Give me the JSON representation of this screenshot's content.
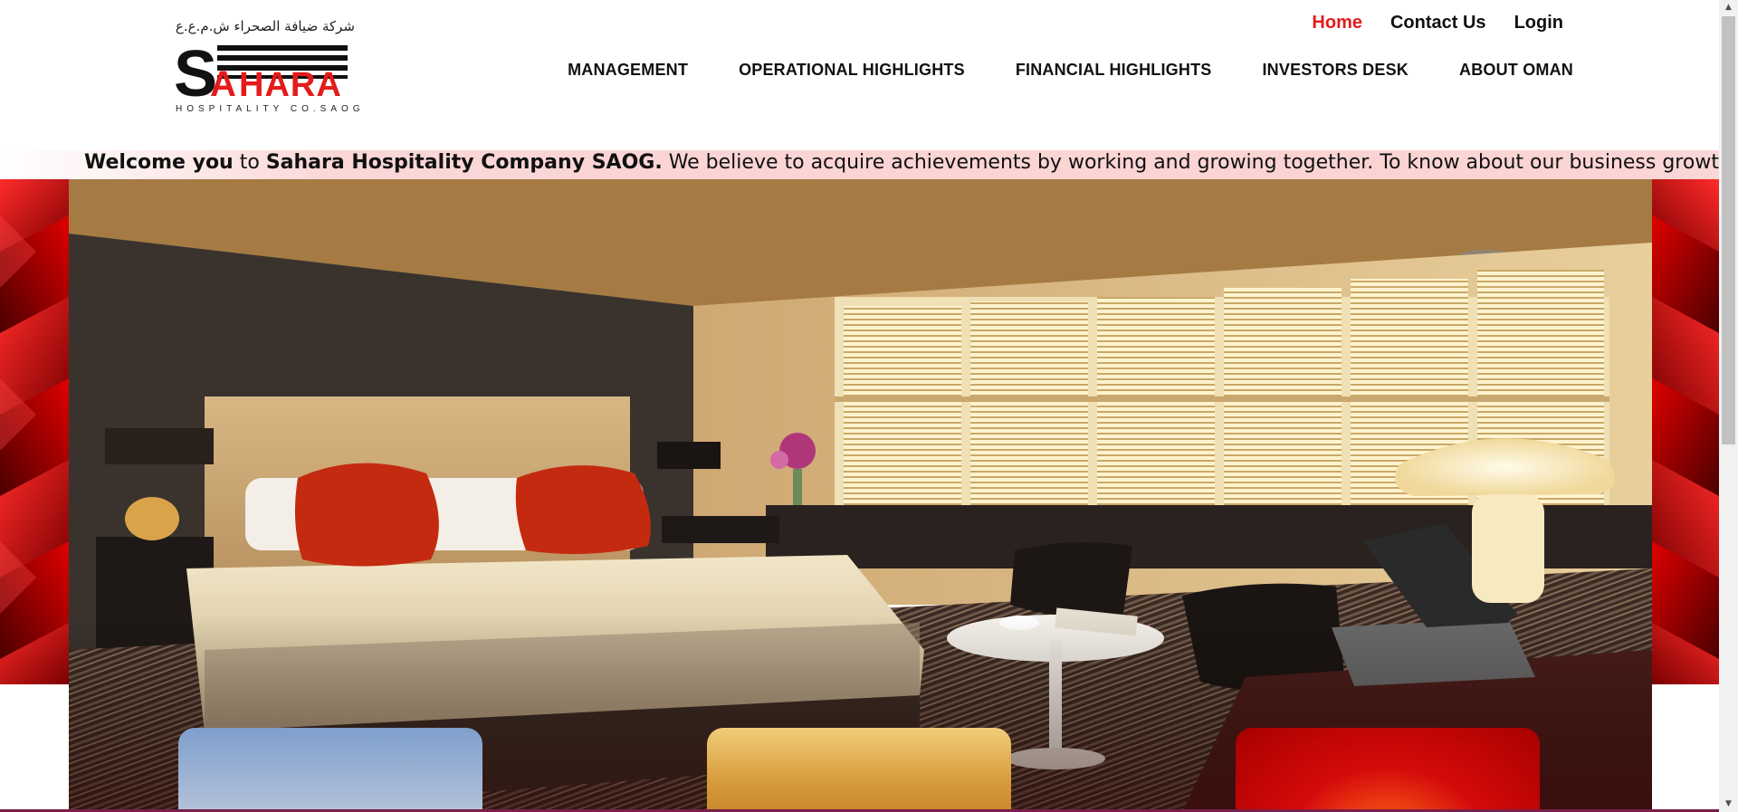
{
  "brand": {
    "arabic_name": "شركة ضيافة الصحراء ش.م.ع.ع",
    "wordmark": "SAHARA",
    "subtitle": "HOSPITALITY CO.SAOG",
    "primary_color": "#e41b1b"
  },
  "top_links": [
    {
      "label": "Home",
      "active": true
    },
    {
      "label": "Contact Us",
      "active": false
    },
    {
      "label": "Login",
      "active": false
    }
  ],
  "main_nav": [
    {
      "label": "MANAGEMENT"
    },
    {
      "label": "OPERATIONAL HIGHLIGHTS"
    },
    {
      "label": "FINANCIAL HIGHLIGHTS"
    },
    {
      "label": "INVESTORS DESK"
    },
    {
      "label": "ABOUT OMAN"
    }
  ],
  "marquee": {
    "welcome_bold": "Welcome you",
    "to": "to",
    "company_bold": "Sahara Hospitality Company SAOG.",
    "rest": "We believe to acquire achievements by working and growing together. To know about our business growth"
  },
  "hero": {
    "image": "hotel-bedroom-photo"
  },
  "cards": [
    {
      "image": "sky-photo"
    },
    {
      "image": "interior-photo"
    },
    {
      "image": "red-abstract-photo"
    }
  ]
}
